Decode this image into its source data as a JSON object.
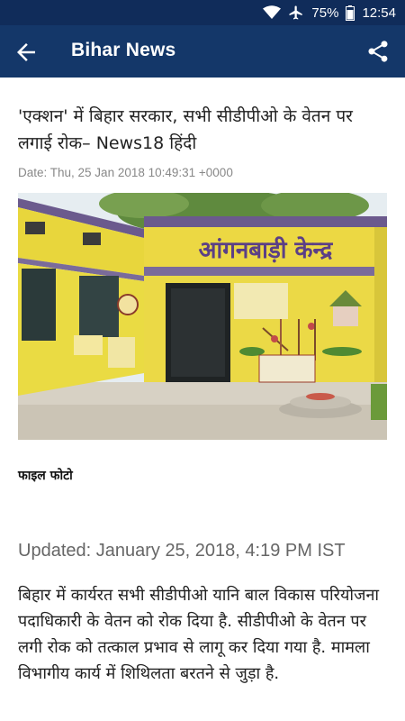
{
  "status_bar": {
    "battery": "75%",
    "time": "12:54",
    "icons": [
      "wifi-icon",
      "airplane-icon",
      "battery-icon"
    ]
  },
  "app_bar": {
    "title": "Bihar News",
    "back_icon": "arrow-left-icon",
    "share_icon": "share-icon"
  },
  "article": {
    "headline": "'एक्शन' में बिहार सरकार, सभी सीडीपीओ के वेतन पर लगाई रोक– News18 हिंदी",
    "date": "Date: Thu, 25 Jan 2018 10:49:31 +0000",
    "image_sign_text": "आंगनबाड़ी केन्द्र",
    "image_caption": "फाइल फोटो",
    "updated": "Updated: January 25, 2018, 4:19 PM IST",
    "body": "बिहार में कार्यरत सभी सीडीपीओ यानि बाल विकास परियोजना पदाधिकारी के वेतन को रोक दिया है. सीडीपीओ के वेतन पर लगी रोक को तत्काल प्रभाव से लागू कर दिया गया है. मामला विभागीय कार्य में शिथिलता बरतने से जुड़ा है."
  },
  "colors": {
    "status_bar": "#102c5a",
    "app_bar": "#143769",
    "text": "#222222",
    "muted": "#888888"
  }
}
